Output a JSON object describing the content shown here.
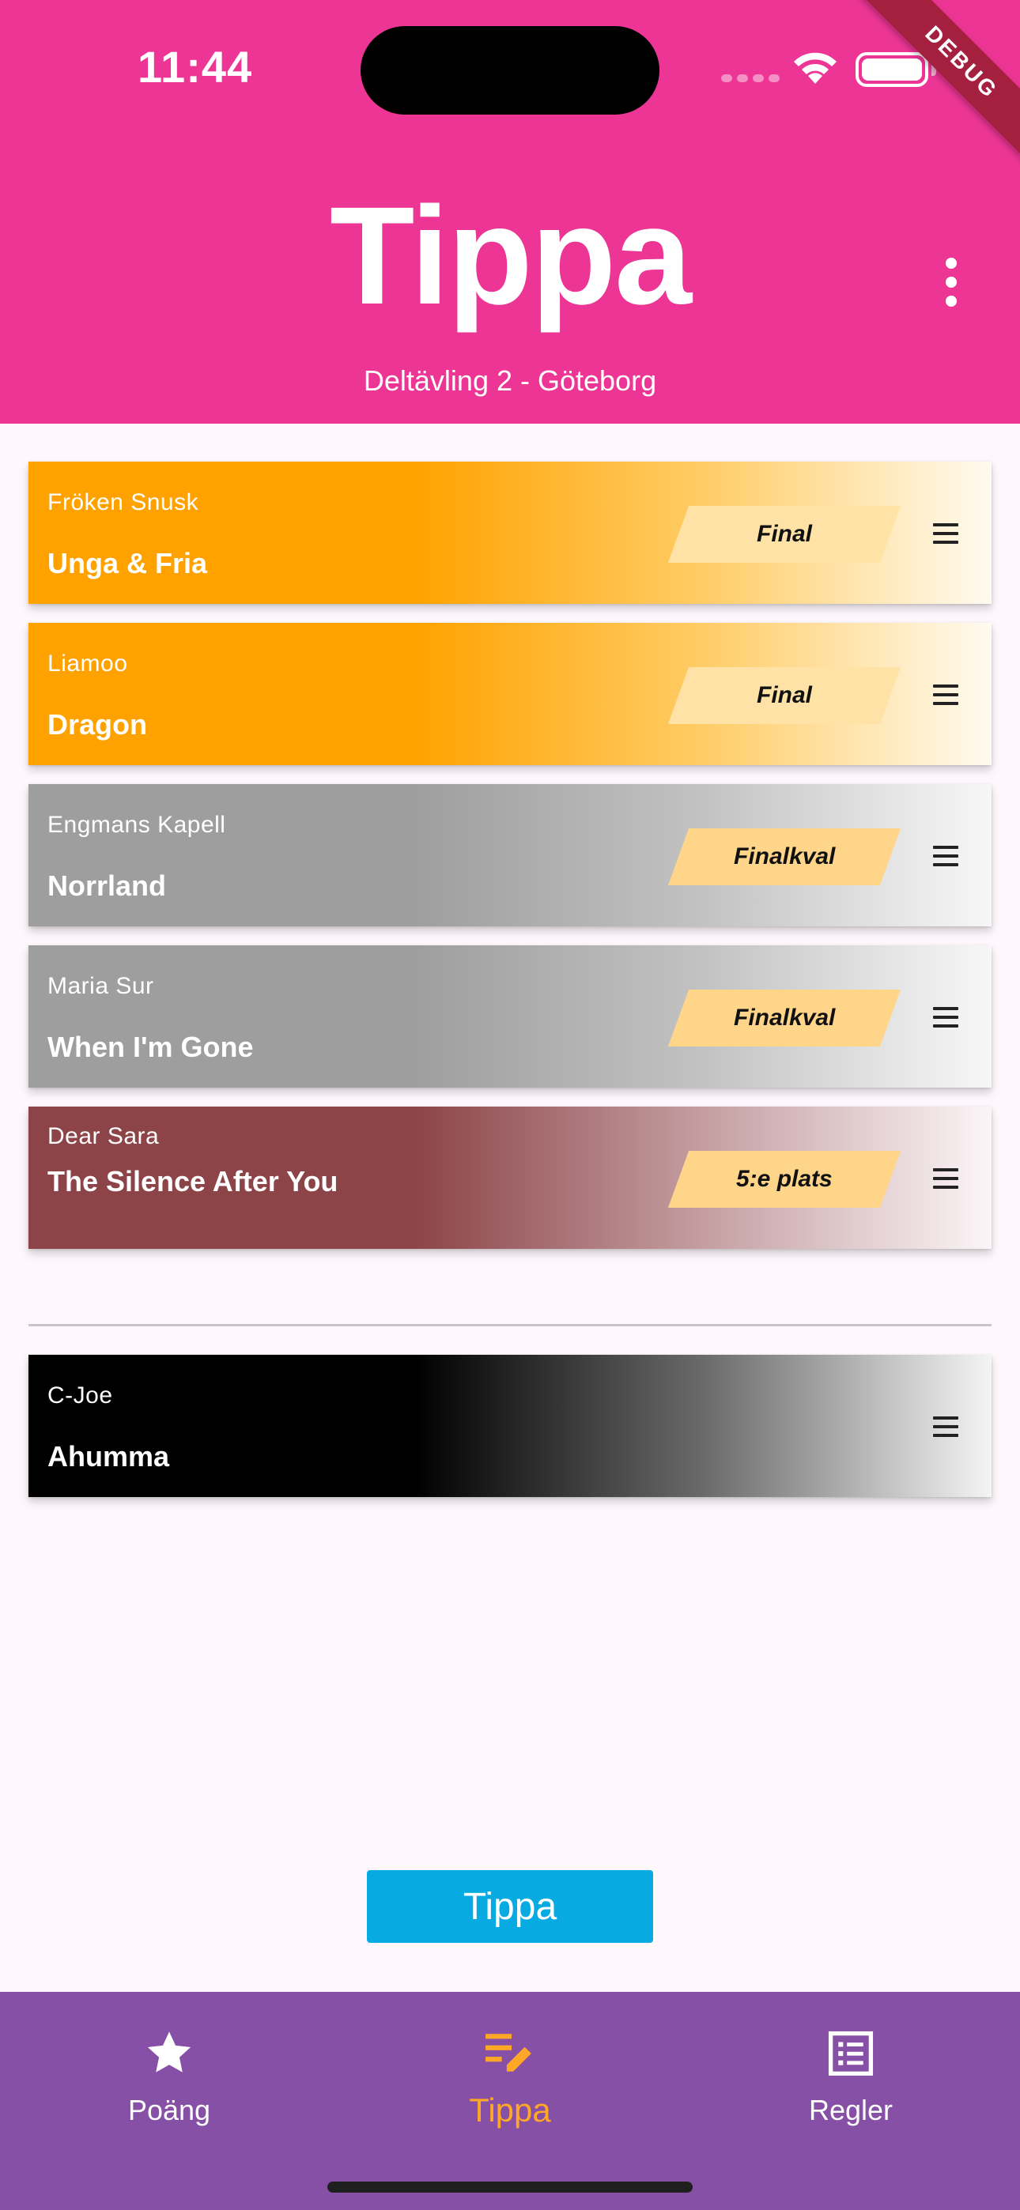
{
  "status_bar": {
    "time": "11:44",
    "debug_label": "DEBUG"
  },
  "header": {
    "title": "Tippa",
    "subtitle": "Deltävling 2 - Göteborg"
  },
  "ranked_entries": [
    {
      "artist": "Fröken Snusk",
      "song": "Unga & Fria",
      "result": "Final"
    },
    {
      "artist": "Liamoo",
      "song": "Dragon",
      "result": "Final"
    },
    {
      "artist": "Engmans Kapell",
      "song": "Norrland",
      "result": "Finalkval"
    },
    {
      "artist": "Maria Sur",
      "song": "When I'm Gone",
      "result": "Finalkval"
    },
    {
      "artist": "Dear Sara",
      "song": "The Silence After You",
      "result": "5:e plats"
    }
  ],
  "eliminated_entries": [
    {
      "artist": "C-Joe",
      "song": "Ahumma"
    }
  ],
  "submit_button": {
    "label": "Tippa"
  },
  "bottom_nav": {
    "items": [
      {
        "label": "Poäng",
        "icon": "star-icon",
        "active": false
      },
      {
        "label": "Tippa",
        "icon": "edit-list-icon",
        "active": true
      },
      {
        "label": "Regler",
        "icon": "list-box-icon",
        "active": false
      }
    ]
  },
  "colors": {
    "header_bg": "#ec3594",
    "final": "#ffa200",
    "finalkval": "#9e9e9e",
    "fifth_place": "#8c4448",
    "eliminated": "#000000",
    "badge": "#ffd58a",
    "submit_button": "#07abe1",
    "bottom_nav_bg": "#8550a5",
    "active_nav": "#ffa726"
  }
}
